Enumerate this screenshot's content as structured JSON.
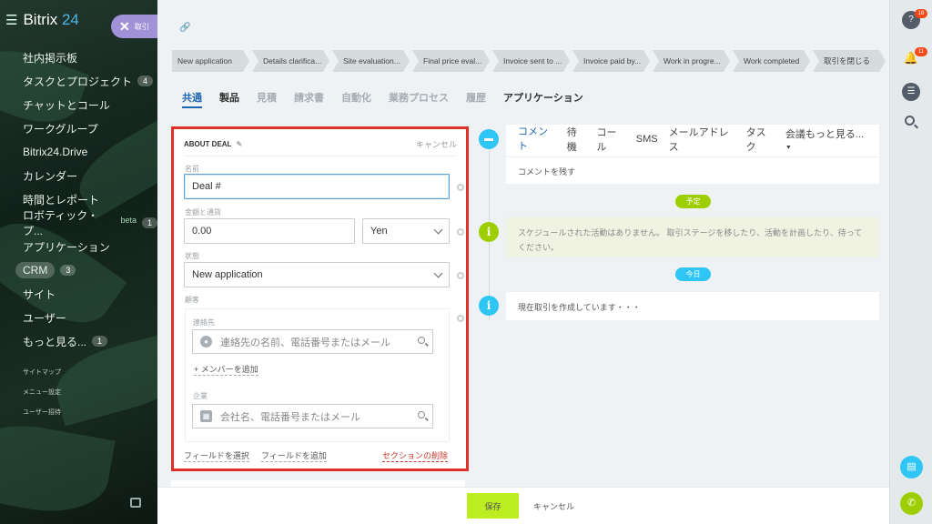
{
  "sidebar": {
    "logo_prefix": "Bitrix",
    "logo_number": "24",
    "items": [
      {
        "label": "社内掲示板",
        "badge": ""
      },
      {
        "label": "タスクとプロジェクト",
        "badge": "4"
      },
      {
        "label": "チャットとコール",
        "badge": ""
      },
      {
        "label": "ワークグループ",
        "badge": ""
      },
      {
        "label": "Bitrix24.Drive",
        "badge": ""
      },
      {
        "label": "カレンダー",
        "badge": ""
      },
      {
        "label": "時間とレポート",
        "badge": ""
      },
      {
        "label": "ロボティック・プ...",
        "badge": "1",
        "beta": "beta"
      },
      {
        "label": "アプリケーション",
        "badge": ""
      },
      {
        "label": "CRM",
        "badge": "3"
      },
      {
        "label": "サイト",
        "badge": ""
      },
      {
        "label": "ユーザー",
        "badge": ""
      },
      {
        "label": "もっと見る...",
        "badge": "1"
      }
    ],
    "small_links": [
      "サイトマップ",
      "メニュー設定",
      "ユーザー招待"
    ]
  },
  "slider": {
    "close_label": "取引"
  },
  "stages": [
    "New application",
    "Details clarifica...",
    "Site evaluation...",
    "Final price eval...",
    "Invoice sent to ...",
    "Invoice paid by...",
    "Work in progre...",
    "Work completed",
    "取引を閉じる"
  ],
  "tabs": [
    "共通",
    "製品",
    "見積",
    "請求書",
    "自動化",
    "業務プロセス",
    "履歴",
    "アプリケーション"
  ],
  "card": {
    "title": "ABOUT DEAL",
    "cancel": "キャンセル",
    "name_label": "名前",
    "name_value": "Deal #",
    "amount_label": "金額と通貨",
    "amount_value": "0.00",
    "currency_value": "Yen",
    "status_label": "状態",
    "status_value": "New application",
    "client_label": "顧客",
    "contact_label": "連絡先",
    "contact_placeholder": "連絡先の名前、電話番号またはメール",
    "add_member": "+ メンバーを追加",
    "company_label": "企業",
    "company_placeholder": "会社名、電話番号またはメール",
    "select_field": "フィールドを選択",
    "add_field": "フィールドを追加",
    "delete_section": "セクションの削除"
  },
  "timeline": {
    "tabs": [
      "コメント",
      "待機",
      "コール",
      "SMS",
      "メールアドレス",
      "タスク",
      "会議もっと見る..."
    ],
    "comment_placeholder": "コメントを残す",
    "planned_label": "予定",
    "schedule_text": "スケジュールされた活動はありません。 取引ステージを移したり、活動を計画したり、待ってください。",
    "today_label": "今日",
    "current_text": "現在取引を作成しています・・・"
  },
  "footer": {
    "save": "保存",
    "cancel": "キャンセル"
  },
  "rail": {
    "help_badge": "18",
    "notif_badge": "11"
  },
  "colors": {
    "accent_blue": "#2066b0",
    "highlight_red": "#e0302a",
    "save_green": "#bbed21",
    "planned_green": "#9dcf00",
    "today_blue": "#2fc6f6"
  }
}
